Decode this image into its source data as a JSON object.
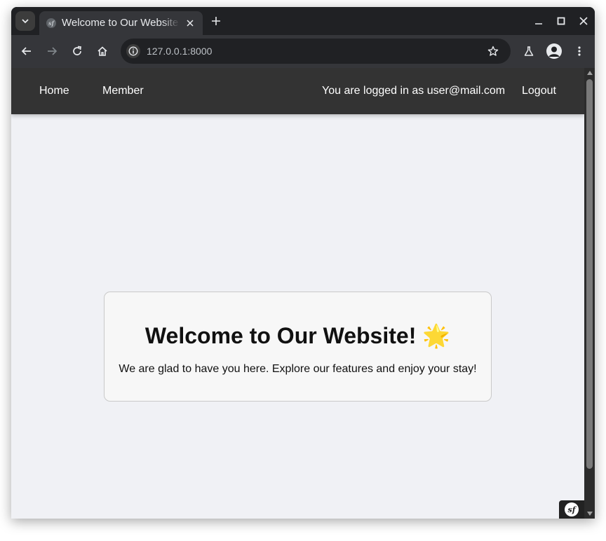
{
  "browser": {
    "tab": {
      "title": "Welcome to Our Website",
      "favicon_text": "sf"
    },
    "address_bar": {
      "url": "127.0.0.1:8000"
    },
    "icons": [
      "tab-search-icon",
      "close-icon",
      "plus-icon",
      "minimize-icon",
      "maximize-icon",
      "window-close-icon",
      "back-arrow-icon",
      "forward-arrow-icon",
      "reload-icon",
      "home-icon",
      "info-icon",
      "star-icon",
      "labs-flask-icon",
      "profile-icon",
      "more-vert-icon"
    ]
  },
  "navbar": {
    "home_label": "Home",
    "member_label": "Member",
    "logged_in_text": "You are logged in as user@mail.com",
    "logout_label": "Logout"
  },
  "card": {
    "title": "Welcome to Our Website! 🌟",
    "text": "We are glad to have you here. Explore our features and enjoy your stay!"
  },
  "debug_toolbar": {
    "logo_text": "sf"
  },
  "colors": {
    "navbar_bg": "#333333",
    "page_bg": "#f0f1f5",
    "card_bg": "#f7f7f7",
    "browser_frame": "#202124",
    "browser_toolbar": "#35363a"
  }
}
